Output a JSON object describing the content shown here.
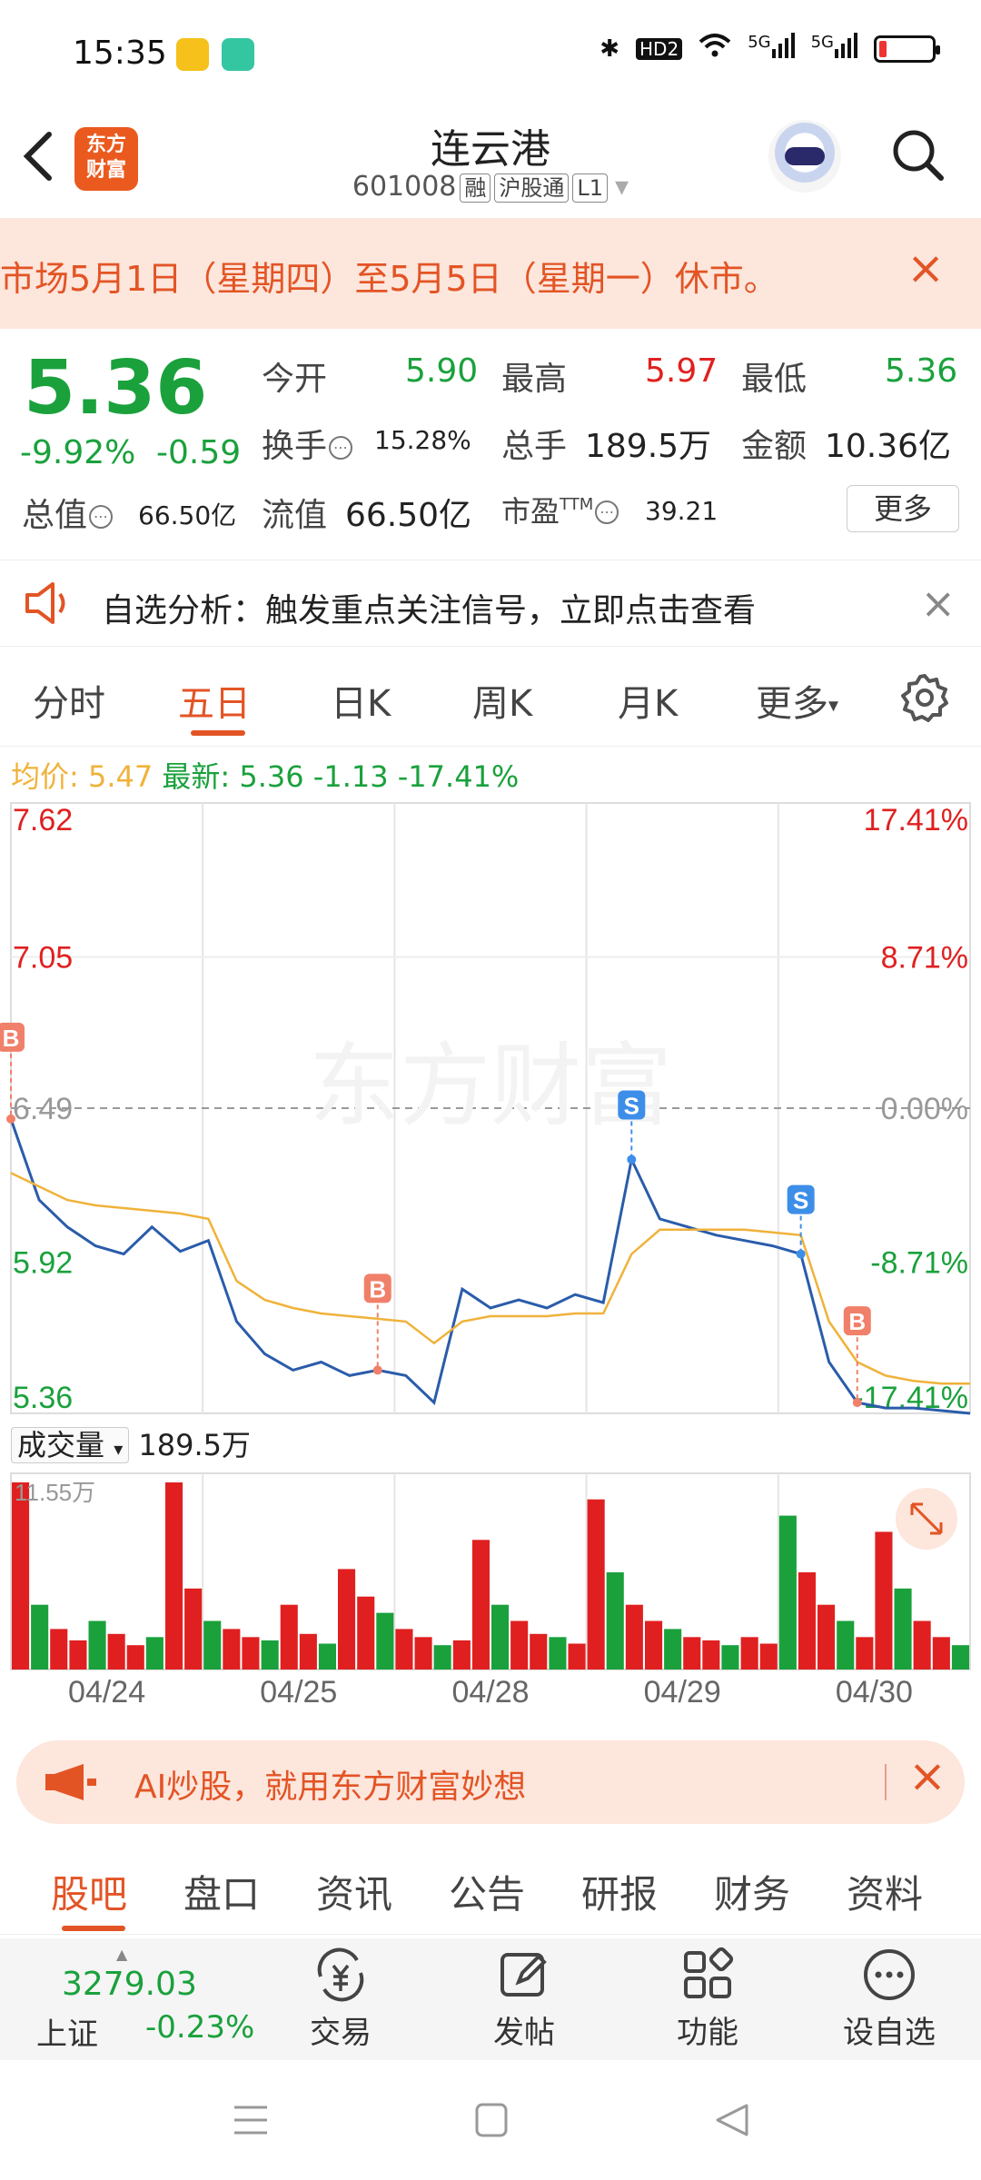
{
  "status_bar": {
    "time": "15:35",
    "hd_label": "HD2",
    "sig1": "5G",
    "sig2": "5G"
  },
  "header": {
    "back": "<",
    "logo": "东方\n财富",
    "stock_name": "连云港",
    "stock_code": "601008",
    "tags": [
      "融",
      "沪股通",
      "L1"
    ]
  },
  "notice": {
    "text": "市场5月1日（星期四）至5月5日（星期一）休市。",
    "close": "×"
  },
  "quote": {
    "price": "5.36",
    "change_pct": "-9.92%",
    "change_amt": "-0.59",
    "open_label": "今开",
    "open": "5.90",
    "high_label": "最高",
    "high": "5.97",
    "low_label": "最低",
    "low": "5.36",
    "turnover_label": "换手",
    "turnover": "15.28%",
    "volume_label": "总手",
    "volume": "189.5万",
    "amount_label": "金额",
    "amount": "10.36亿",
    "mktcap_label": "总值",
    "mktcap": "66.50亿",
    "float_label": "流值",
    "float": "66.50亿",
    "pe_label": "市盈",
    "pe_sup": "TTM",
    "pe": "39.21",
    "more": "更多"
  },
  "signal": {
    "text": "自选分析：触发重点关注信号，立即点击查看",
    "close": "×"
  },
  "chart_tabs": [
    "分时",
    "五日",
    "日K",
    "周K",
    "月K",
    "更多"
  ],
  "chart_info": {
    "avg_label": "均价:",
    "avg": "5.47",
    "latest_label": "最新:",
    "latest": "5.36",
    "chg": "-1.13",
    "pct": "-17.41%"
  },
  "chart_data": {
    "type": "line",
    "y_left_ticks": [
      "7.62",
      "7.05",
      "6.49",
      "5.92",
      "5.36"
    ],
    "y_right_ticks": [
      "17.41%",
      "8.71%",
      "0.00%",
      "-8.71%",
      "-17.41%"
    ],
    "x_labels": [
      "04/24",
      "04/25",
      "04/28",
      "04/29",
      "04/30"
    ],
    "ylim": [
      5.36,
      7.62
    ],
    "series": [
      {
        "values": [
          6.45,
          6.15,
          6.05,
          5.98,
          5.95,
          6.05,
          5.96,
          6.0,
          5.7,
          5.58,
          5.52,
          5.55,
          5.5,
          5.52,
          5.5,
          5.4,
          5.82,
          5.75,
          5.78,
          5.75,
          5.8,
          5.77,
          6.3,
          6.08,
          6.05,
          6.02,
          6.0,
          5.98,
          5.95,
          5.55,
          5.4,
          5.38,
          5.38,
          5.37,
          5.36
        ]
      },
      {
        "values": [
          6.25,
          6.2,
          6.15,
          6.13,
          6.12,
          6.11,
          6.1,
          6.08,
          5.85,
          5.78,
          5.75,
          5.73,
          5.72,
          5.71,
          5.7,
          5.62,
          5.7,
          5.72,
          5.72,
          5.72,
          5.73,
          5.73,
          5.95,
          6.04,
          6.04,
          6.04,
          6.04,
          6.03,
          6.02,
          5.7,
          5.55,
          5.5,
          5.48,
          5.47,
          5.47
        ]
      }
    ],
    "markers": [
      "B",
      "B",
      "S",
      "S",
      "B"
    ],
    "volume_max": "11.55万",
    "volume": [
      11.55,
      4,
      2.5,
      1.8,
      3,
      2.2,
      1.5,
      2,
      11.55,
      5,
      3,
      2.5,
      2,
      1.8,
      4,
      2.2,
      1.6,
      6.2,
      4.5,
      3.5,
      2.5,
      2,
      1.5,
      1.8,
      8,
      4,
      3,
      2.2,
      2,
      1.6,
      10.5,
      6,
      4,
      3,
      2.5,
      2,
      1.8,
      1.5,
      2,
      1.6,
      9.5,
      6,
      4,
      3,
      2,
      8.5,
      5,
      3,
      2,
      1.5
    ]
  },
  "volume_selector": {
    "label": "成交量",
    "total": "189.5万"
  },
  "ai_banner": {
    "text": "AI炒股，就用东方财富妙想",
    "close": "×"
  },
  "bottom_tabs": [
    "股吧",
    "盘口",
    "资讯",
    "公告",
    "研报",
    "财务",
    "资料"
  ],
  "toolbar": {
    "index_value": "3279.03",
    "index_name": "上证",
    "index_change": "-0.23%",
    "items": [
      "交易",
      "发帖",
      "功能",
      "设自选"
    ]
  },
  "colors": {
    "accent": "#e35425",
    "up": "#e02020",
    "down": "#1aa13c",
    "avg": "#f0b23a",
    "price_line": "#2a5caa"
  }
}
